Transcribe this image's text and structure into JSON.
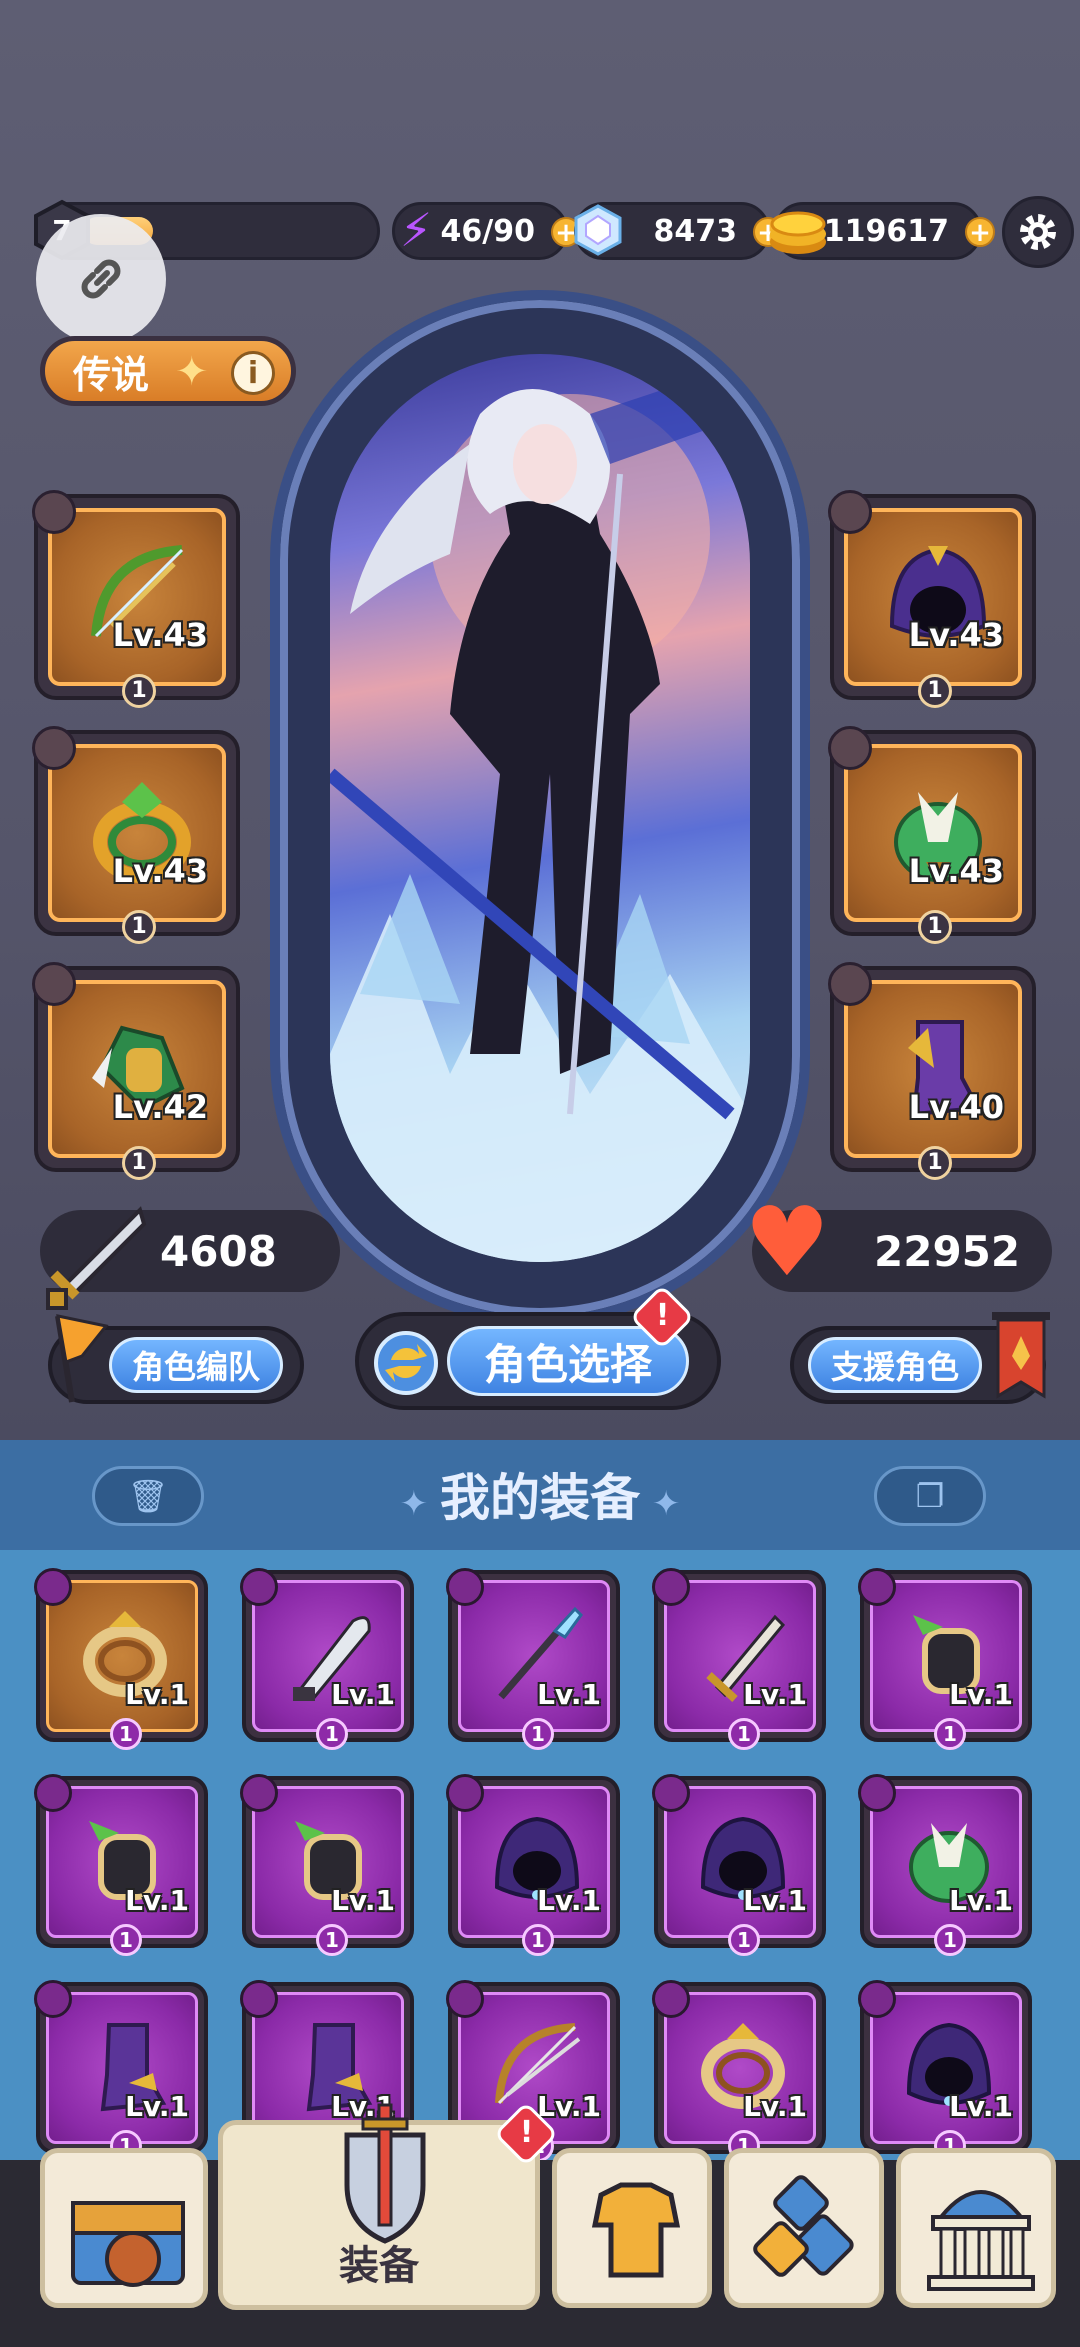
{
  "top_bar": {
    "xp_level": "7",
    "xp_progress": 0.25,
    "energy": "46/90",
    "gems": "8473",
    "gold": "119617"
  },
  "character": {
    "rarity": "传说",
    "attack": "4608",
    "hp": "22952"
  },
  "equipped": {
    "left": [
      {
        "icon": "bow-icon",
        "level": "Lv.43",
        "stars": "1"
      },
      {
        "icon": "ring-icon",
        "level": "Lv.43",
        "stars": "1"
      },
      {
        "icon": "bracer-icon",
        "level": "Lv.42",
        "stars": "1"
      }
    ],
    "right": [
      {
        "icon": "hood-icon",
        "level": "Lv.43",
        "stars": "1"
      },
      {
        "icon": "armor-icon",
        "level": "Lv.43",
        "stars": "1"
      },
      {
        "icon": "boots-icon",
        "level": "Lv.40",
        "stars": "1"
      }
    ]
  },
  "actions": {
    "team": "角色编队",
    "select": "角色选择",
    "select_alert": "!",
    "support": "支援角色"
  },
  "inventory": {
    "title": "我的装备",
    "items": [
      {
        "icon": "ring-icon",
        "level": "Lv.1",
        "stars": "1",
        "rarity": "gold"
      },
      {
        "icon": "dagger-icon",
        "level": "Lv.1",
        "stars": "1",
        "rarity": "purple"
      },
      {
        "icon": "spear-icon",
        "level": "Lv.1",
        "stars": "1",
        "rarity": "purple"
      },
      {
        "icon": "sword-icon",
        "level": "Lv.1",
        "stars": "1",
        "rarity": "purple"
      },
      {
        "icon": "bracer-icon",
        "level": "Lv.1",
        "stars": "1",
        "rarity": "purple"
      },
      {
        "icon": "bracer-icon",
        "level": "Lv.1",
        "stars": "1",
        "rarity": "purple"
      },
      {
        "icon": "bracer-icon",
        "level": "Lv.1",
        "stars": "1",
        "rarity": "purple"
      },
      {
        "icon": "hood-icon",
        "level": "Lv.1",
        "stars": "1",
        "rarity": "purple"
      },
      {
        "icon": "hood-icon",
        "level": "Lv.1",
        "stars": "1",
        "rarity": "purple"
      },
      {
        "icon": "armor-icon",
        "level": "Lv.1",
        "stars": "1",
        "rarity": "purple"
      },
      {
        "icon": "boots-icon",
        "level": "Lv.1",
        "stars": "1",
        "rarity": "purple"
      },
      {
        "icon": "boots-icon",
        "level": "Lv.1",
        "stars": "1",
        "rarity": "purple"
      },
      {
        "icon": "bow-icon",
        "level": "Lv.1",
        "stars": "1",
        "rarity": "purple"
      },
      {
        "icon": "ring-icon",
        "level": "Lv.1",
        "stars": "1",
        "rarity": "purple"
      },
      {
        "icon": "hood-icon",
        "level": "Lv.1",
        "stars": "1",
        "rarity": "purple"
      }
    ]
  },
  "bottom_nav": {
    "equipment_label": "装备",
    "equipment_alert": "!"
  },
  "colors": {
    "gold_rarity": "#a86428",
    "purple_rarity": "#8b2aa8",
    "inventory_bg": "#4b90c4",
    "accent_blue": "#3f83e2"
  }
}
